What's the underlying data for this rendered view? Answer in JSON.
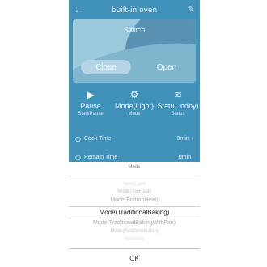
{
  "header": {
    "title": "built-in oven",
    "back_icon": "back-arrow-icon",
    "edit_icon": "edit-pencil-icon"
  },
  "switch": {
    "label": "Switch",
    "close_label": "Close",
    "open_label": "Open"
  },
  "modes": [
    {
      "icon": "play-icon",
      "main": "Pause",
      "sub": "Start/Pause"
    },
    {
      "icon": "gear-icon",
      "main": "Mode(Light)",
      "sub": "Mode"
    },
    {
      "icon": "heat-icon",
      "main": "Statu...ndby)",
      "sub": "Status"
    }
  ],
  "rows": {
    "cook_time": {
      "label": "Cook Time",
      "value": "0min"
    },
    "remain_time": {
      "label": "Remain Time",
      "value": "0min"
    }
  },
  "picker": {
    "title": "Mode",
    "options_above": [
      "Mode(Light)",
      "Mode(TopHeat)",
      "Mode(BottomHeat)"
    ],
    "selected": "Mode(TraditionalBaking)",
    "options_below": [
      "Mode(TraditionalBakingWithFan)",
      "Mode(FanConvection)",
      "Mode(Grill)"
    ],
    "ok_label": "OK"
  },
  "colors": {
    "app_bg": "#1f7fb0",
    "sheet_bg": "#ffffff"
  }
}
